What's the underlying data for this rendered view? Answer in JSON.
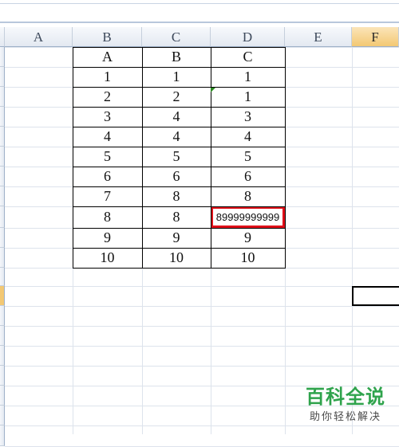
{
  "columns": [
    "A",
    "B",
    "C",
    "D",
    "E",
    "F"
  ],
  "selected_column": "F",
  "table": {
    "header": [
      "A",
      "B",
      "C"
    ],
    "rows": [
      [
        "1",
        "1",
        "1"
      ],
      [
        "2",
        "2",
        "1"
      ],
      [
        "3",
        "4",
        "3"
      ],
      [
        "4",
        "4",
        "4"
      ],
      [
        "5",
        "5",
        "5"
      ],
      [
        "6",
        "6",
        "6"
      ],
      [
        "7",
        "8",
        "8"
      ],
      [
        "8",
        "8",
        "89999999999"
      ],
      [
        "9",
        "9",
        "9"
      ],
      [
        "10",
        "10",
        "10"
      ]
    ],
    "highlighted_cell": "D10"
  },
  "watermark": {
    "title": "百科全说",
    "subtitle": "助你轻松解决"
  },
  "colors": {
    "highlight_border": "#e0101a",
    "selected_header": "#f3c873",
    "error_indicator": "#2b8a22",
    "watermark_green": "#2fa34c"
  }
}
